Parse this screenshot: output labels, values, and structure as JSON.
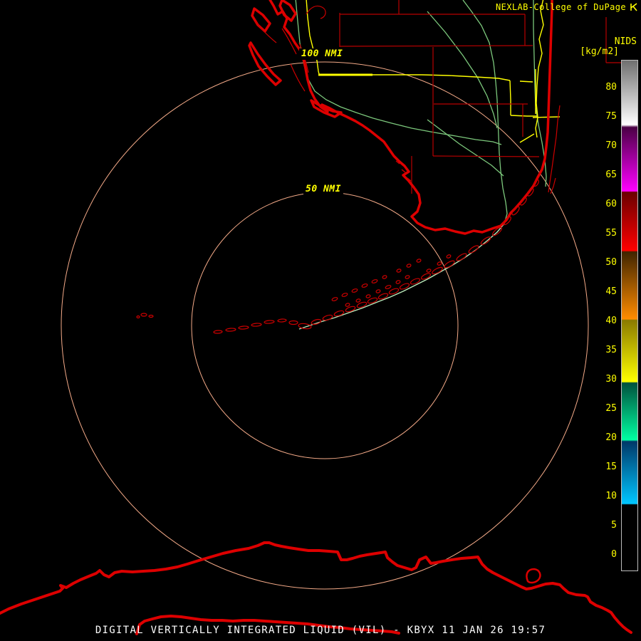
{
  "colors": {
    "bg": "#000000",
    "coast": "#dd0000",
    "thin-red": "#cc0000",
    "county": "#b80000",
    "ring": "#f4aa88",
    "highway": "#ffff00",
    "road-green": "#7cc87c",
    "road-light": "#b9e8b9",
    "label-yellow": "#ffff00",
    "caption-white": "#ffffff",
    "cb-border": "#bdbdbd"
  },
  "header": {
    "brand": "NEXLAB-College of DuPage",
    "logo_icon": "cod-lightning-logo"
  },
  "colorbar": {
    "title": "NIDS",
    "units": "[kg/m2]",
    "tick_values": [
      80,
      75,
      70,
      65,
      60,
      55,
      50,
      45,
      40,
      35,
      30,
      25,
      20,
      15,
      10,
      5,
      0
    ],
    "segments": [
      {
        "name": "gray",
        "from": 73,
        "to": 84,
        "color_top": "#6f6f6f",
        "color_bottom": "#ffffff"
      },
      {
        "name": "magenta",
        "from": 62,
        "to": 73,
        "color_top": "#4a0045",
        "color_bottom": "#ff00ff"
      },
      {
        "name": "red",
        "from": 52,
        "to": 62,
        "color_top": "#6a0000",
        "color_bottom": "#ff0000"
      },
      {
        "name": "orange",
        "from": 40,
        "to": 52,
        "color_top": "#3f2400",
        "color_bottom": "#ff8c00"
      },
      {
        "name": "yellow",
        "from": 30,
        "to": 40,
        "color_top": "#8a7a00",
        "color_bottom": "#ffff00"
      },
      {
        "name": "teal",
        "from": 19,
        "to": 30,
        "color_top": "#00513d",
        "color_bottom": "#00ffa2"
      },
      {
        "name": "blue",
        "from": 9,
        "to": 19,
        "color_top": "#003868",
        "color_bottom": "#00c6ff"
      },
      {
        "name": "black",
        "from": 0,
        "to": 9,
        "color_top": "#000000",
        "color_bottom": "#000000"
      }
    ]
  },
  "map": {
    "rings": [
      {
        "label": "50 NMI",
        "radius_nmi": 50
      },
      {
        "label": "100 NMI",
        "radius_nmi": 100
      }
    ]
  },
  "caption": {
    "text": "DIGITAL VERTICALLY INTEGRATED LIQUID (VIL) - KBYX 11 JAN 26 19:57",
    "product": "DIGITAL VERTICALLY INTEGRATED LIQUID (VIL)",
    "station": "KBYX",
    "datetime": "11 JAN 26 19:57"
  }
}
